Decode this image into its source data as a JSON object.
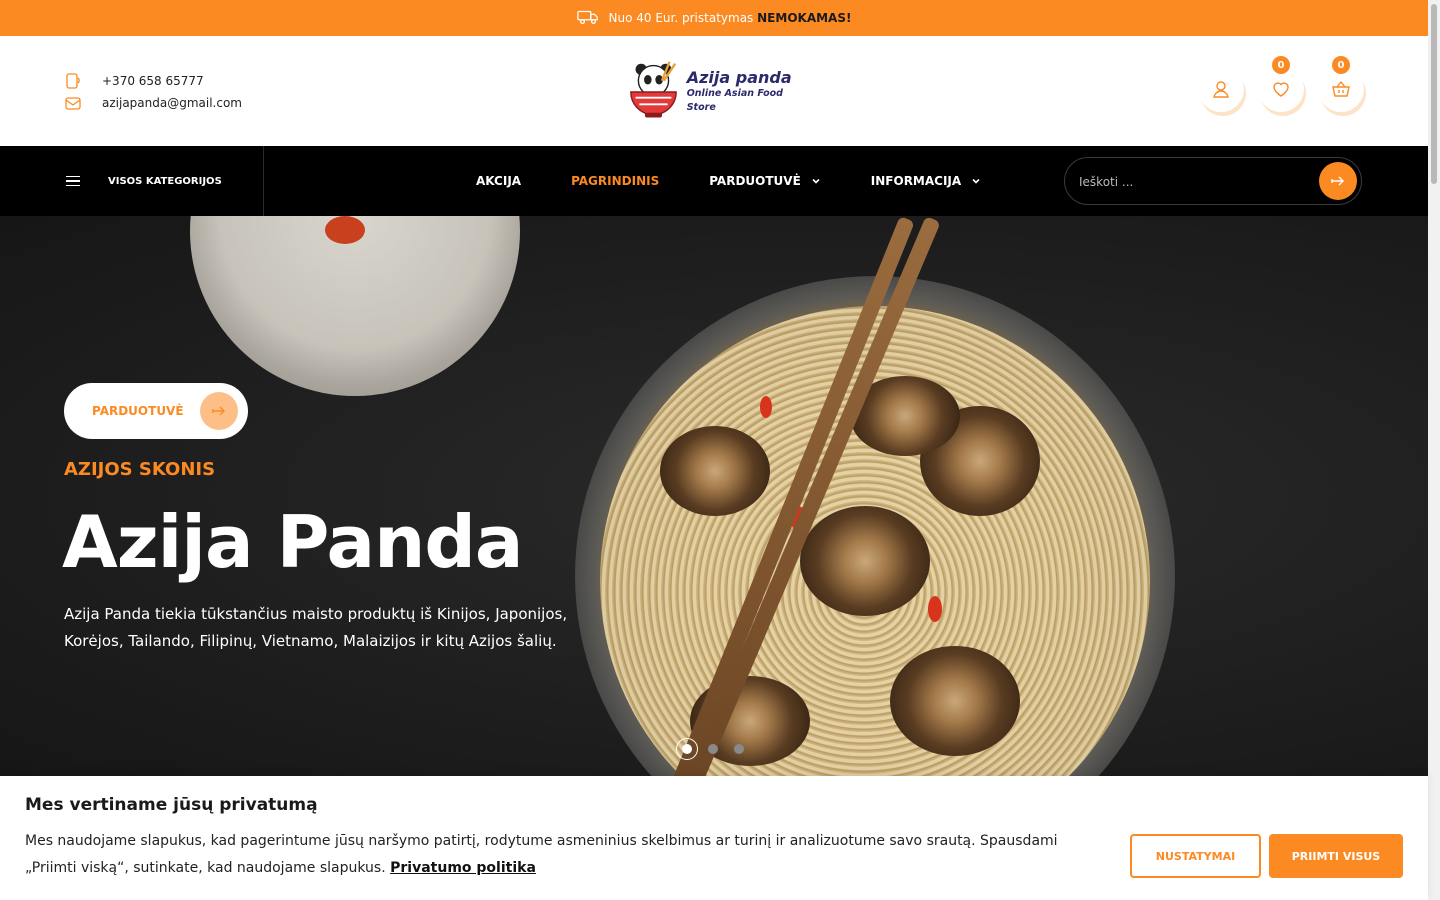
{
  "colors": {
    "accent": "#fb8a23",
    "nav_bg": "#000000",
    "text": "#222222"
  },
  "promo": {
    "text": "Nuo 40 Eur. pristatymas",
    "highlight": "NEMOKAMAS!",
    "icon": "truck-icon"
  },
  "header": {
    "phone": "+370 658 65777",
    "email": "azijapanda@gmail.com",
    "logo": {
      "name": "Azija panda",
      "tagline": "Online Asian Food Store"
    },
    "wishlist_count": "0",
    "cart_count": "0"
  },
  "nav": {
    "categories_label": "VISOS KATEGORIJOS",
    "items": [
      {
        "label": "AKCIJA",
        "active": false,
        "dropdown": false
      },
      {
        "label": "PAGRINDINIS",
        "active": true,
        "dropdown": false
      },
      {
        "label": "PARDUOTUVĖ",
        "active": false,
        "dropdown": true
      },
      {
        "label": "INFORMACIJA",
        "active": false,
        "dropdown": true
      }
    ],
    "search_placeholder": "Ieškoti ..."
  },
  "hero": {
    "button_label": "PARDUOTUVĖ",
    "subtitle": "AZIJOS SKONIS",
    "title": "Azija Panda",
    "description": "Azija Panda tiekia tūkstančius maisto produktų iš Kinijos, Japonijos, Korėjos, Tailando, Filipinų, Vietnamo, Malaizijos ir kitų Azijos šalių.",
    "slides": 3,
    "active_slide": 1
  },
  "cookie": {
    "title": "Mes vertiname jūsų privatumą",
    "text": "Mes naudojame slapukus, kad pagerintume jūsų naršymo patirtį, rodytume asmeninius skelbimus ar turinį ir analizuotume savo srautą. Spausdami „Priimti viską“, sutinkate, kad naudojame slapukus.",
    "policy_link": "Privatumo politika",
    "settings_label": "NUSTATYMAI",
    "accept_label": "PRIIMTI VISUS"
  }
}
